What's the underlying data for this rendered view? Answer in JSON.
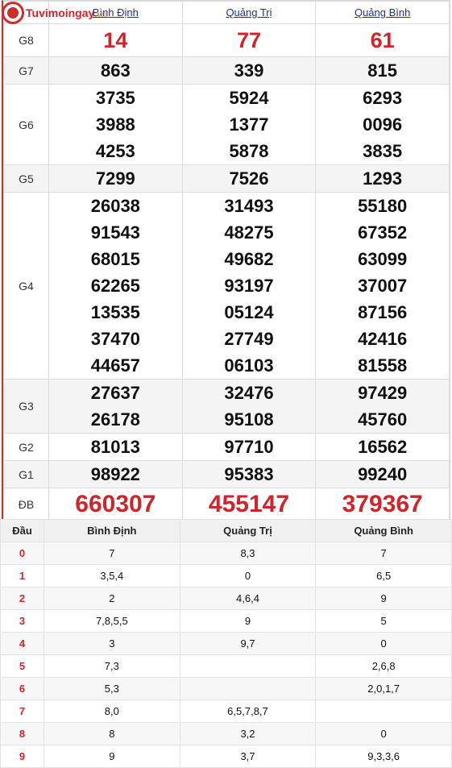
{
  "logo": {
    "text": "Tuvimoingay",
    "suffix": ".vn"
  },
  "provinces": [
    "Bình Định",
    "Quảng Trị",
    "Quảng Bình"
  ],
  "prizes": {
    "g8": {
      "label": "G8",
      "values": [
        "14",
        "77",
        "61"
      ]
    },
    "g7": {
      "label": "G7",
      "values": [
        "863",
        "339",
        "815"
      ]
    },
    "g6": {
      "label": "G6",
      "values": [
        [
          "3735",
          "3988",
          "4253"
        ],
        [
          "5924",
          "1377",
          "5878"
        ],
        [
          "6293",
          "0096",
          "3835"
        ]
      ]
    },
    "g5": {
      "label": "G5",
      "values": [
        "7299",
        "7526",
        "1293"
      ]
    },
    "g4": {
      "label": "G4",
      "values": [
        [
          "26038",
          "91543",
          "68015",
          "62265",
          "13535",
          "37470",
          "44657"
        ],
        [
          "31493",
          "48275",
          "49682",
          "93197",
          "05124",
          "27749",
          "06103"
        ],
        [
          "55180",
          "67352",
          "63099",
          "37007",
          "87156",
          "42416",
          "81558"
        ]
      ]
    },
    "g3": {
      "label": "G3",
      "values": [
        [
          "27637",
          "26178"
        ],
        [
          "32476",
          "95108"
        ],
        [
          "97429",
          "45760"
        ]
      ]
    },
    "g2": {
      "label": "G2",
      "values": [
        "81013",
        "97710",
        "16562"
      ]
    },
    "g1": {
      "label": "G1",
      "values": [
        "98922",
        "95383",
        "99240"
      ]
    },
    "db": {
      "label": "ĐB",
      "values": [
        "660307",
        "455147",
        "379367"
      ]
    }
  },
  "loto": {
    "headers": [
      "Đầu",
      "Bình Định",
      "Quảng Trị",
      "Quảng Bình"
    ],
    "rows": [
      {
        "dau": "0",
        "cols": [
          "7",
          "8,3",
          "7"
        ]
      },
      {
        "dau": "1",
        "cols": [
          "3,5,4",
          "0",
          "6,5"
        ]
      },
      {
        "dau": "2",
        "cols": [
          "2",
          "4,6,4",
          "9"
        ]
      },
      {
        "dau": "3",
        "cols": [
          "7,8,5,5",
          "9",
          "5"
        ]
      },
      {
        "dau": "4",
        "cols": [
          "3",
          "9,7",
          "0"
        ]
      },
      {
        "dau": "5",
        "cols": [
          "7,3",
          "",
          "2,6,8"
        ]
      },
      {
        "dau": "6",
        "cols": [
          "5,3",
          "",
          "2,0,1,7"
        ]
      },
      {
        "dau": "7",
        "cols": [
          "8,0",
          "6,5,7,8,7",
          ""
        ]
      },
      {
        "dau": "8",
        "cols": [
          "8",
          "3,2",
          "0"
        ]
      },
      {
        "dau": "9",
        "cols": [
          "9",
          "3,7",
          "9,3,3,6"
        ]
      }
    ]
  }
}
